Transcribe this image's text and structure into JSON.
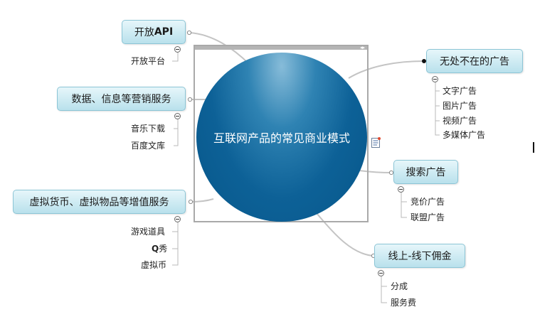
{
  "central_topic": "互联网产品的常见商业模式",
  "branches": {
    "open_api": {
      "label_prefix": "开放",
      "label_bold": "API",
      "children": [
        "开放平台"
      ]
    },
    "data_services": {
      "label": "数据、信息等营销服务",
      "children": [
        "音乐下载",
        "百度文库"
      ]
    },
    "virtual_goods": {
      "label": "虚拟货币、虚拟物品等增值服务",
      "children": [
        {
          "bold": "",
          "text": "游戏道具"
        },
        {
          "bold": "Q",
          "text": "秀"
        },
        {
          "bold": "",
          "text": "虚拟币"
        }
      ]
    },
    "ads": {
      "label": "无处不在的广告",
      "children": [
        "文字广告",
        "图片广告",
        "视频广告",
        "多媒体广告"
      ]
    },
    "search_ads": {
      "label": "搜索广告",
      "children": [
        "竞价广告",
        "联盟广告"
      ]
    },
    "o2o": {
      "label": "线上-线下佣金",
      "children": [
        "分成",
        "服务费"
      ]
    }
  },
  "frame_bar_icon": "◂▸",
  "colors": {
    "central_fill": "#0d6197",
    "topic_fill": "#b9e1ec",
    "topic_border": "#8cc5d6",
    "connector": "#c0c0c0"
  }
}
